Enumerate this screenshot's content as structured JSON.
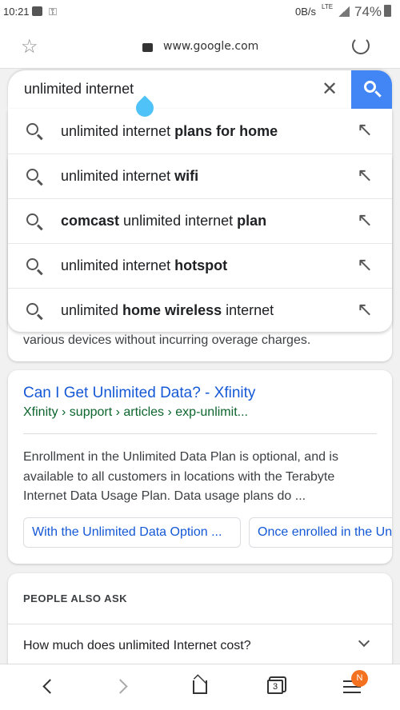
{
  "status_bar": {
    "time": "10:21",
    "net_speed": "0B/s",
    "network": "LTE",
    "battery": "74%"
  },
  "browser": {
    "url": "www.google.com",
    "tab_count": "3",
    "menu_badge": "N"
  },
  "search": {
    "query": "unlimited internet"
  },
  "suggestions": [
    {
      "parts": [
        [
          "unlimited internet ",
          false
        ],
        [
          "plans for home",
          true
        ]
      ]
    },
    {
      "parts": [
        [
          "unlimited internet ",
          false
        ],
        [
          "wifi",
          true
        ]
      ]
    },
    {
      "parts": [
        [
          "comcast",
          true
        ],
        [
          " unlimited internet ",
          false
        ],
        [
          "plan",
          true
        ]
      ]
    },
    {
      "parts": [
        [
          "unlimited internet ",
          false
        ],
        [
          "hotspot",
          true
        ]
      ]
    },
    {
      "parts": [
        [
          "unlimited ",
          false
        ],
        [
          "home wireless",
          true
        ],
        [
          " internet",
          false
        ]
      ]
    }
  ],
  "results": {
    "prev_snippet_tail": "various devices without incurring overage charges.",
    "xfinity": {
      "title": "Can I Get Unlimited Data? - Xfinity",
      "breadcrumb": "Xfinity › support › articles › exp-unlimit...",
      "snippet_lines": [
        "Enrollment in the Unlimited Data Plan is optional, and is",
        "available to all customers in locations with the Terabyte",
        "Internet Data Usage Plan. Data usage plans do ..."
      ],
      "chips": [
        "With the Unlimited Data Option ...",
        "Once enrolled in the Unlimited"
      ]
    },
    "people_also_ask": {
      "heading": "PEOPLE ALSO ASK",
      "questions": [
        "How much does unlimited Internet cost?"
      ]
    }
  },
  "colors": {
    "accent": "#4285f4",
    "link": "#1558d6",
    "url_green": "#0d652d",
    "badge": "#f4711f",
    "cursor_handle": "#4fc3f7"
  }
}
